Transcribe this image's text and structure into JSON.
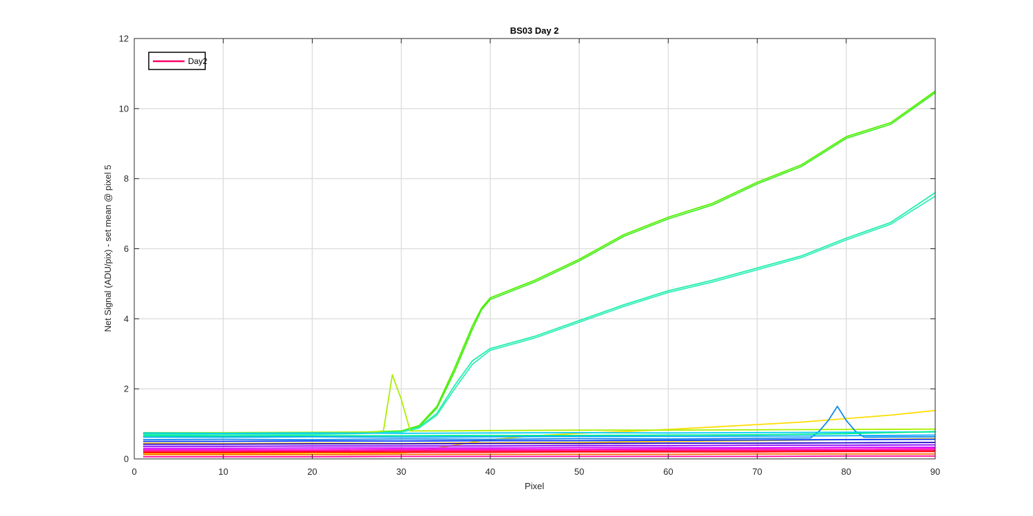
{
  "chart_data": {
    "type": "line",
    "title": "BS03 Day 2",
    "xlabel": "Pixel",
    "ylabel": "Net Signal (ADU/pix) - set mean @ pixel 5",
    "xlim": [
      0,
      90
    ],
    "ylim": [
      0,
      12
    ],
    "xticks": [
      0,
      10,
      20,
      30,
      40,
      50,
      60,
      70,
      80,
      90
    ],
    "yticks": [
      0,
      2,
      4,
      6,
      8,
      10,
      12
    ],
    "grid": true,
    "legend": {
      "position": "top-left",
      "entries": [
        {
          "name": "Day2",
          "color": "#ff0066"
        }
      ]
    },
    "series": [
      {
        "color": "#55ee00",
        "x": [
          1,
          10,
          20,
          25,
          30,
          32,
          34,
          36,
          38,
          39,
          40,
          45,
          50,
          55,
          60,
          65,
          70,
          75,
          80,
          85,
          90
        ],
        "y": [
          0.72,
          0.73,
          0.74,
          0.76,
          0.8,
          0.95,
          1.5,
          2.6,
          3.8,
          4.3,
          4.6,
          5.1,
          5.7,
          6.4,
          6.9,
          7.3,
          7.9,
          8.4,
          9.2,
          9.6,
          10.5
        ]
      },
      {
        "color": "#44ee22",
        "x": [
          1,
          10,
          20,
          25,
          30,
          32,
          34,
          36,
          38,
          39,
          40,
          45,
          50,
          55,
          60,
          65,
          70,
          75,
          80,
          85,
          90
        ],
        "y": [
          0.7,
          0.71,
          0.73,
          0.75,
          0.78,
          0.92,
          1.45,
          2.5,
          3.7,
          4.25,
          4.55,
          5.05,
          5.65,
          6.35,
          6.85,
          7.25,
          7.85,
          8.35,
          9.15,
          9.55,
          10.45
        ]
      },
      {
        "color": "#22eeaa",
        "x": [
          1,
          10,
          20,
          25,
          30,
          32,
          34,
          36,
          38,
          40,
          45,
          50,
          55,
          60,
          65,
          70,
          75,
          80,
          85,
          90
        ],
        "y": [
          0.7,
          0.71,
          0.72,
          0.74,
          0.77,
          0.9,
          1.3,
          2.1,
          2.8,
          3.15,
          3.5,
          3.95,
          4.4,
          4.8,
          5.1,
          5.45,
          5.8,
          6.3,
          6.75,
          7.6
        ]
      },
      {
        "color": "#33eebb",
        "x": [
          1,
          10,
          20,
          25,
          30,
          32,
          34,
          36,
          38,
          40,
          45,
          50,
          55,
          60,
          65,
          70,
          75,
          80,
          85,
          90
        ],
        "y": [
          0.68,
          0.69,
          0.7,
          0.72,
          0.76,
          0.88,
          1.25,
          2.0,
          2.7,
          3.1,
          3.45,
          3.9,
          4.35,
          4.75,
          5.05,
          5.4,
          5.75,
          6.25,
          6.7,
          7.5
        ]
      },
      {
        "color": "#ffdd00",
        "x": [
          1,
          10,
          20,
          30,
          32,
          35,
          38,
          40,
          45,
          50,
          55,
          60,
          65,
          70,
          75,
          80,
          85,
          90
        ],
        "y": [
          0.15,
          0.15,
          0.16,
          0.17,
          0.22,
          0.35,
          0.48,
          0.55,
          0.66,
          0.73,
          0.78,
          0.84,
          0.91,
          0.98,
          1.05,
          1.15,
          1.25,
          1.38
        ]
      },
      {
        "color": "#ffcc00",
        "x": [
          1,
          10,
          20,
          30,
          40,
          50,
          60,
          70,
          80,
          90
        ],
        "y": [
          0.45,
          0.44,
          0.45,
          0.44,
          0.46,
          0.47,
          0.5,
          0.52,
          0.55,
          0.58
        ]
      },
      {
        "color": "#aaee00",
        "x": [
          1,
          10,
          20,
          27,
          28,
          29,
          30,
          31,
          35,
          40,
          50,
          60,
          70,
          80,
          90
        ],
        "y": [
          0.75,
          0.75,
          0.76,
          0.77,
          0.8,
          2.4,
          1.7,
          0.8,
          0.8,
          0.81,
          0.82,
          0.82,
          0.83,
          0.84,
          0.85
        ]
      },
      {
        "color": "#1188ee",
        "x": [
          1,
          10,
          20,
          30,
          40,
          50,
          60,
          70,
          76,
          77,
          78,
          79,
          80,
          81,
          82,
          90
        ],
        "y": [
          0.55,
          0.56,
          0.55,
          0.57,
          0.56,
          0.58,
          0.57,
          0.59,
          0.6,
          0.8,
          1.1,
          1.5,
          1.1,
          0.8,
          0.62,
          0.63
        ]
      },
      {
        "color": "#00ccff",
        "x": [
          1,
          10,
          20,
          30,
          40,
          50,
          60,
          70,
          80,
          90
        ],
        "y": [
          0.74,
          0.73,
          0.74,
          0.73,
          0.74,
          0.75,
          0.74,
          0.75,
          0.76,
          0.77
        ]
      },
      {
        "color": "#00ee88",
        "x": [
          1,
          10,
          20,
          30,
          40,
          50,
          60,
          70,
          80,
          90
        ],
        "y": [
          0.66,
          0.65,
          0.66,
          0.66,
          0.67,
          0.67,
          0.68,
          0.69,
          0.72,
          0.78
        ]
      },
      {
        "color": "#00aaff",
        "x": [
          1,
          10,
          20,
          30,
          40,
          50,
          60,
          70,
          80,
          90
        ],
        "y": [
          0.62,
          0.62,
          0.63,
          0.62,
          0.63,
          0.64,
          0.64,
          0.65,
          0.66,
          0.68
        ]
      },
      {
        "color": "#0033ff",
        "x": [
          1,
          10,
          20,
          30,
          40,
          50,
          60,
          70,
          80,
          90
        ],
        "y": [
          0.5,
          0.5,
          0.51,
          0.51,
          0.52,
          0.52,
          0.53,
          0.54,
          0.55,
          0.56
        ]
      },
      {
        "color": "#2200cc",
        "x": [
          1,
          10,
          20,
          30,
          40,
          50,
          60,
          70,
          80,
          90
        ],
        "y": [
          0.42,
          0.42,
          0.43,
          0.43,
          0.44,
          0.44,
          0.45,
          0.45,
          0.46,
          0.47
        ]
      },
      {
        "color": "#8800ff",
        "x": [
          1,
          10,
          20,
          30,
          40,
          50,
          60,
          70,
          80,
          90
        ],
        "y": [
          0.36,
          0.36,
          0.37,
          0.37,
          0.37,
          0.38,
          0.38,
          0.39,
          0.39,
          0.4
        ]
      },
      {
        "color": "#cc00ff",
        "x": [
          1,
          10,
          20,
          30,
          40,
          50,
          60,
          70,
          80,
          90
        ],
        "y": [
          0.3,
          0.3,
          0.31,
          0.31,
          0.31,
          0.32,
          0.32,
          0.32,
          0.33,
          0.33
        ]
      },
      {
        "color": "#ff00cc",
        "x": [
          1,
          10,
          20,
          30,
          40,
          50,
          60,
          70,
          80,
          90
        ],
        "y": [
          0.26,
          0.26,
          0.26,
          0.27,
          0.27,
          0.27,
          0.28,
          0.28,
          0.28,
          0.29
        ]
      },
      {
        "color": "#ff0066",
        "x": [
          1,
          10,
          20,
          30,
          40,
          50,
          60,
          70,
          80,
          90
        ],
        "y": [
          0.22,
          0.22,
          0.22,
          0.23,
          0.23,
          0.23,
          0.24,
          0.24,
          0.24,
          0.25
        ]
      },
      {
        "color": "#ff0000",
        "x": [
          1,
          10,
          20,
          30,
          40,
          50,
          60,
          70,
          80,
          90
        ],
        "y": [
          0.18,
          0.18,
          0.19,
          0.19,
          0.19,
          0.2,
          0.2,
          0.2,
          0.21,
          0.21
        ]
      },
      {
        "color": "#ff6600",
        "x": [
          1,
          10,
          20,
          30,
          40,
          50,
          60,
          70,
          80,
          90
        ],
        "y": [
          0.12,
          0.12,
          0.12,
          0.13,
          0.13,
          0.13,
          0.13,
          0.14,
          0.14,
          0.14
        ]
      },
      {
        "color": "#ff0099",
        "x": [
          1,
          10,
          20,
          30,
          40,
          50,
          60,
          70,
          80,
          90
        ],
        "y": [
          0.06,
          0.06,
          0.06,
          0.07,
          0.07,
          0.07,
          0.07,
          0.07,
          0.08,
          0.08
        ]
      }
    ]
  }
}
